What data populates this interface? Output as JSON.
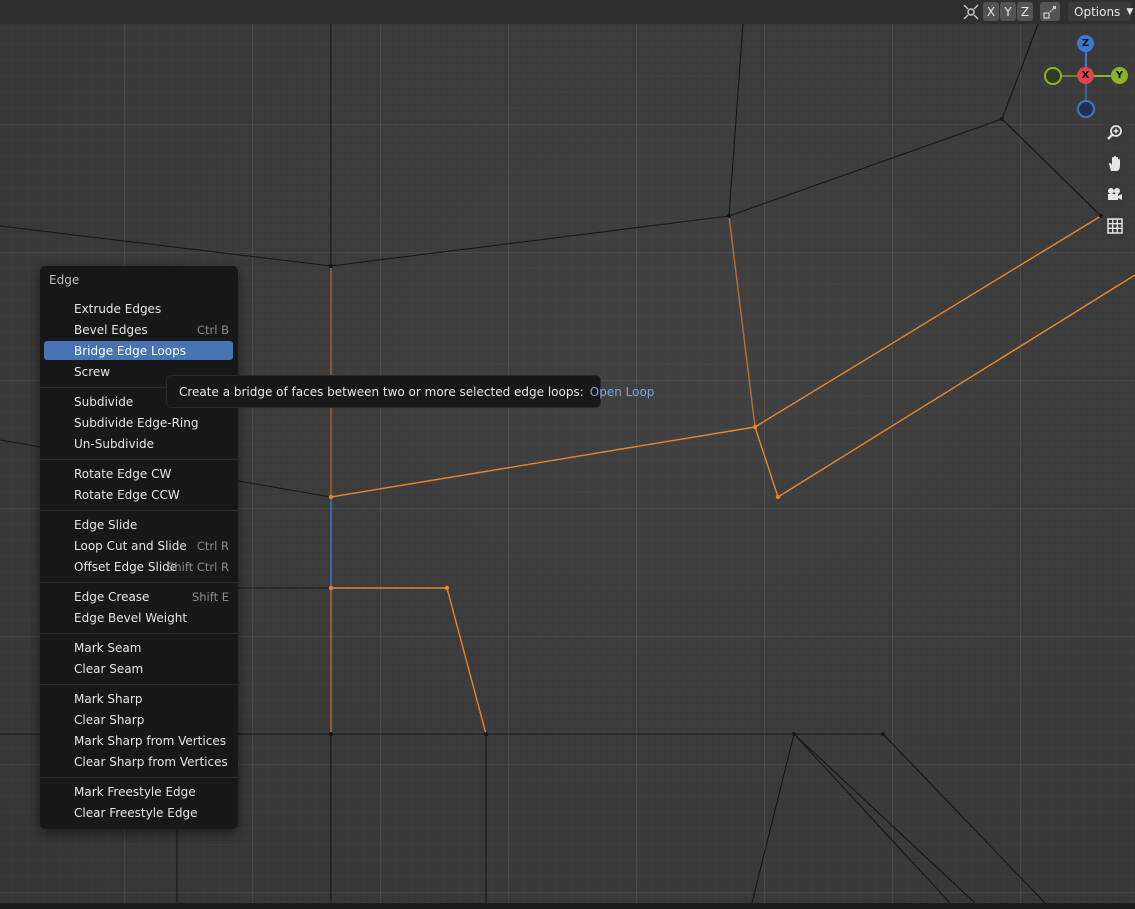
{
  "header": {
    "axis_buttons": [
      "X",
      "Y",
      "Z"
    ],
    "options_label": "Options"
  },
  "gizmo": {
    "z_label": "Z",
    "x_label": "X",
    "y_label": "Y",
    "colors": {
      "x": "#e0434e",
      "y": "#8ab42a",
      "z": "#3c79d1"
    }
  },
  "nav_icons": [
    "zoom-icon",
    "hand-pan-icon",
    "camera-icon",
    "grid-perspective-icon"
  ],
  "menu": {
    "title": "Edge",
    "groups": [
      [
        {
          "label": "Extrude Edges",
          "shortcut": ""
        },
        {
          "label": "Bevel Edges",
          "shortcut": "Ctrl B"
        },
        {
          "label": "Bridge Edge Loops",
          "shortcut": "",
          "active": true
        },
        {
          "label": "Screw",
          "shortcut": ""
        }
      ],
      [
        {
          "label": "Subdivide",
          "shortcut": ""
        },
        {
          "label": "Subdivide Edge-Ring",
          "shortcut": ""
        },
        {
          "label": "Un-Subdivide",
          "shortcut": ""
        }
      ],
      [
        {
          "label": "Rotate Edge CW",
          "shortcut": ""
        },
        {
          "label": "Rotate Edge CCW",
          "shortcut": ""
        }
      ],
      [
        {
          "label": "Edge Slide",
          "shortcut": ""
        },
        {
          "label": "Loop Cut and Slide",
          "shortcut": "Ctrl R"
        },
        {
          "label": "Offset Edge Slide",
          "shortcut": "Shift Ctrl R"
        }
      ],
      [
        {
          "label": "Edge Crease",
          "shortcut": "Shift E"
        },
        {
          "label": "Edge Bevel Weight",
          "shortcut": ""
        }
      ],
      [
        {
          "label": "Mark Seam",
          "shortcut": ""
        },
        {
          "label": "Clear Seam",
          "shortcut": ""
        }
      ],
      [
        {
          "label": "Mark Sharp",
          "shortcut": ""
        },
        {
          "label": "Clear Sharp",
          "shortcut": ""
        },
        {
          "label": "Mark Sharp from Vertices",
          "shortcut": ""
        },
        {
          "label": "Clear Sharp from Vertices",
          "shortcut": ""
        }
      ],
      [
        {
          "label": "Mark Freestyle Edge",
          "shortcut": ""
        },
        {
          "label": "Clear Freestyle Edge",
          "shortcut": ""
        }
      ]
    ]
  },
  "tooltip": {
    "text": "Create a bridge of faces between two or more selected edge loops:",
    "hint": "Open Loop"
  },
  "colors": {
    "selected_edge": "#e8862a",
    "menu_highlight": "#4772b3",
    "edge": "#1a1a1a"
  }
}
